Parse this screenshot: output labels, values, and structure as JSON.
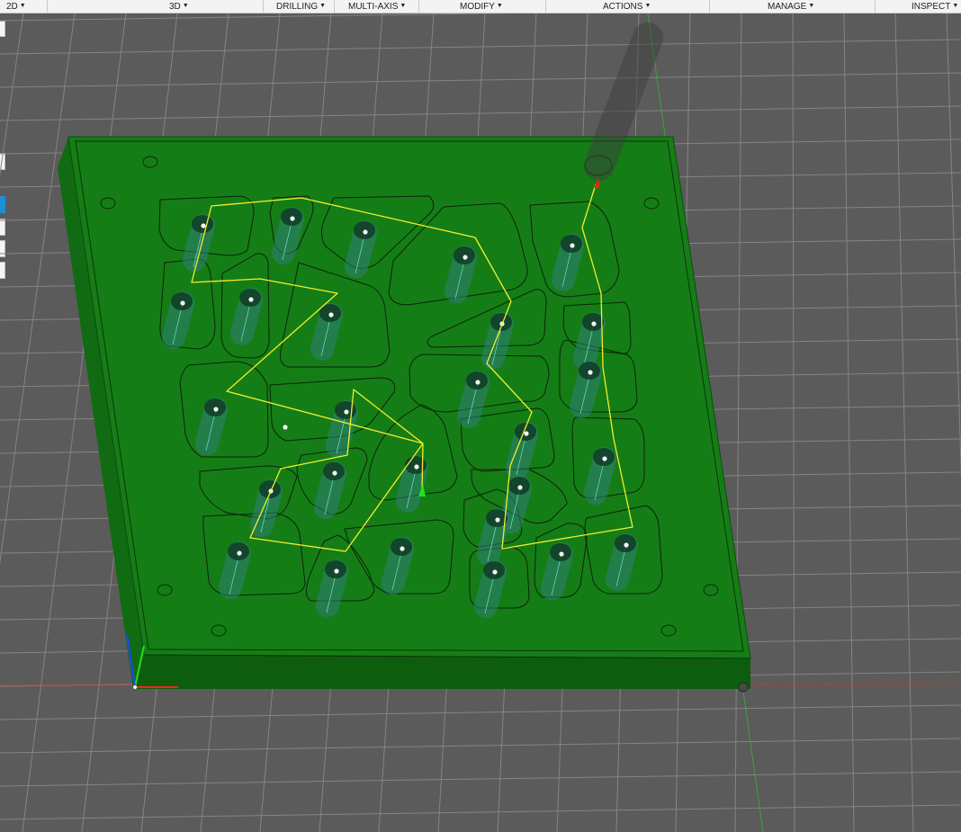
{
  "toolbar": {
    "menus": [
      "2D",
      "3D",
      "DRILLING",
      "MULTI-AXIS",
      "MODIFY",
      "ACTIONS",
      "MANAGE",
      "INSPECT"
    ]
  },
  "viewport": {
    "colors": {
      "background": "#5b5b5b",
      "grid": "#848484",
      "stock_top": "#157d16",
      "stock_front": "#0e5d0f",
      "stock_side": "#116b12",
      "toolpath": "#f2ee2c",
      "tool": "#3e3e3e",
      "start_marker": "#ff1a1a",
      "end_marker": "#22e322",
      "x_axis": "#ff2222",
      "y_axis": "#22dd22",
      "z_axis": "#2244ff"
    }
  }
}
